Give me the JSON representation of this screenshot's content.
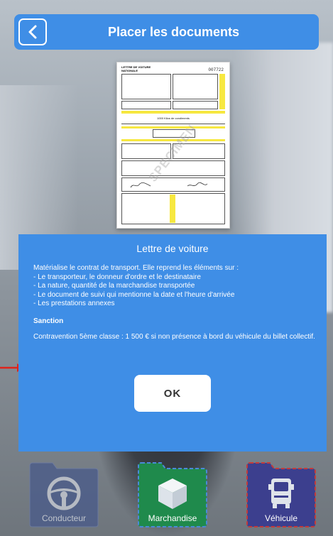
{
  "header": {
    "title": "Placer les documents",
    "back_icon": "chevron-left-icon"
  },
  "document": {
    "title": "LETTRE DE VOITURE",
    "subtitle": "NATIONALE",
    "number": "007722",
    "weight_text": "1000 Kilos de condiments",
    "watermark": "SPECIMEN"
  },
  "modal": {
    "title": "Lettre de voiture",
    "intro": "Matérialise le contrat de transport. Elle reprend les éléments sur :",
    "items": [
      "- Le transporteur, le donneur d'ordre et le destinataire",
      "- La nature, quantité de la marchandise transportée",
      "- Le document de suivi qui mentionne la date et l'heure d'arrivée",
      "- Les prestations annexes"
    ],
    "sanction_heading": "Sanction",
    "sanction_text": "Contravention 5ème classe : 1 500 € si non présence à bord du véhicule du billet collectif.",
    "ok_label": "OK"
  },
  "tabs": [
    {
      "label": "Conducteur",
      "icon": "steering-wheel-icon",
      "color": "#4a5b8a"
    },
    {
      "label": "Marchandise",
      "icon": "package-box-icon",
      "color": "#1f8a4c"
    },
    {
      "label": "Véhicule",
      "icon": "truck-icon",
      "color": "#3c3f8e"
    }
  ],
  "colors": {
    "accent": "#3f8ee6",
    "arrow": "#e0231b"
  }
}
